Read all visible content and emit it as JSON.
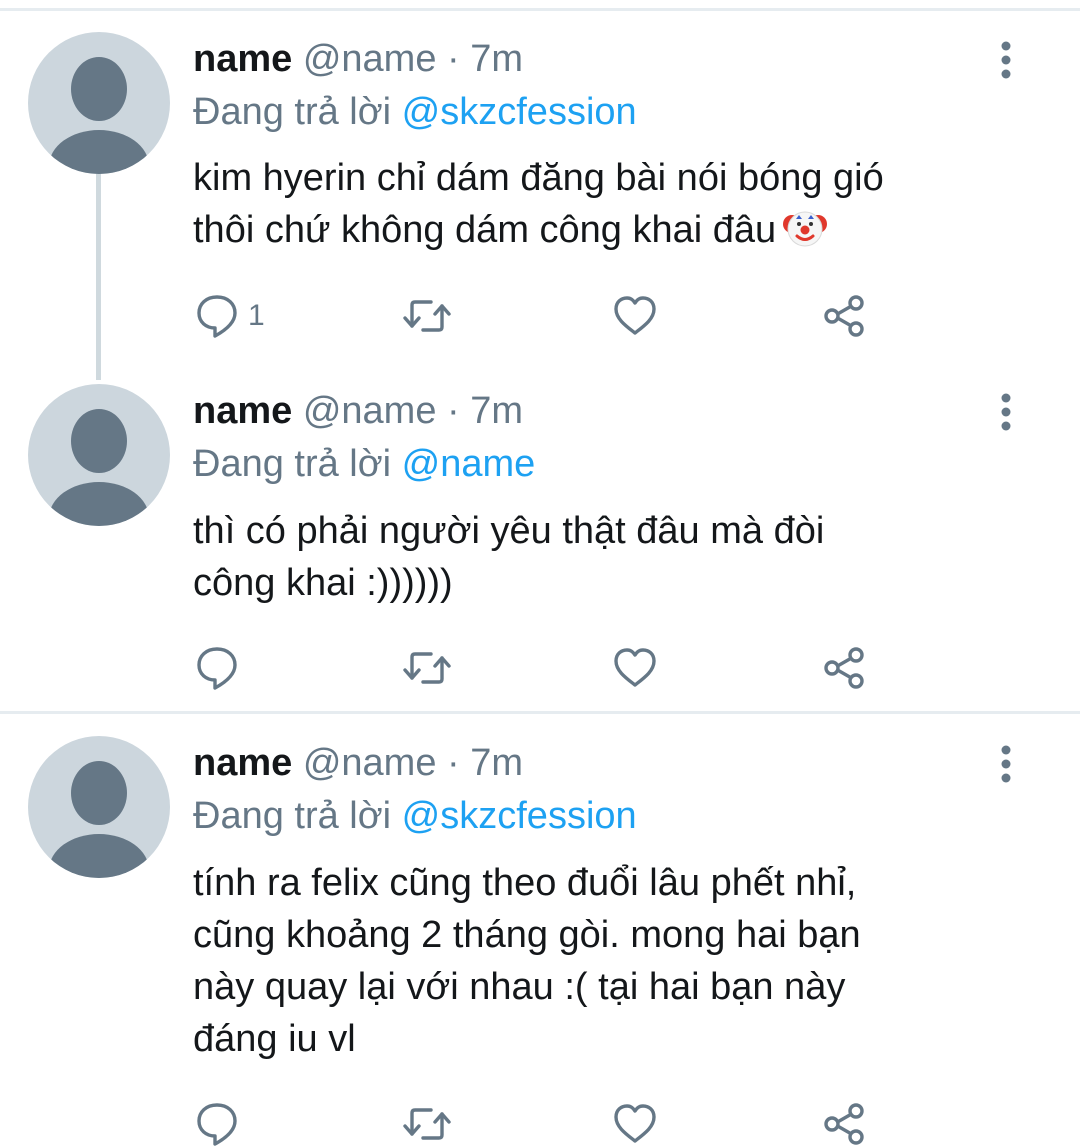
{
  "tweets": [
    {
      "name": "name",
      "handle": "@name",
      "separator": "·",
      "time": "7m",
      "reply_prefix": "Đang trả lời",
      "reply_to": "@skzcfession",
      "text_lines": [
        "kim hyerin chỉ dám đăng bài nói bóng gió",
        "thôi chứ không dám công khai đâu"
      ],
      "emoji": "clown-face",
      "reply_count": "1"
    },
    {
      "name": "name",
      "handle": "@name",
      "separator": "·",
      "time": "7m",
      "reply_prefix": "Đang trả lời",
      "reply_to": "@name",
      "text_lines": [
        "thì có phải người yêu thật đâu mà đòi",
        "công khai :))))))"
      ],
      "reply_count": ""
    },
    {
      "name": "name",
      "handle": "@name",
      "separator": "·",
      "time": "7m",
      "reply_prefix": "Đang trả lời",
      "reply_to": "@skzcfession",
      "text_lines": [
        "tính ra felix cũng theo đuổi lâu phết nhỉ,",
        "cũng khoảng 2 tháng gòi. mong hai bạn",
        "này quay lại với nhau :( tại hai bạn này",
        "đáng iu vl"
      ],
      "reply_count": ""
    }
  ],
  "icons": {
    "reply": "comment-bubble-icon",
    "retweet": "retweet-icon",
    "like": "heart-icon",
    "share": "share-icon",
    "more": "more-vertical-icon"
  },
  "colors": {
    "name": "#14171a",
    "meta": "#657786",
    "mention": "#1da1f2",
    "avatar_bg": "#ccd6dd",
    "avatar_fg": "#657786",
    "divider": "#e6ecf0"
  }
}
